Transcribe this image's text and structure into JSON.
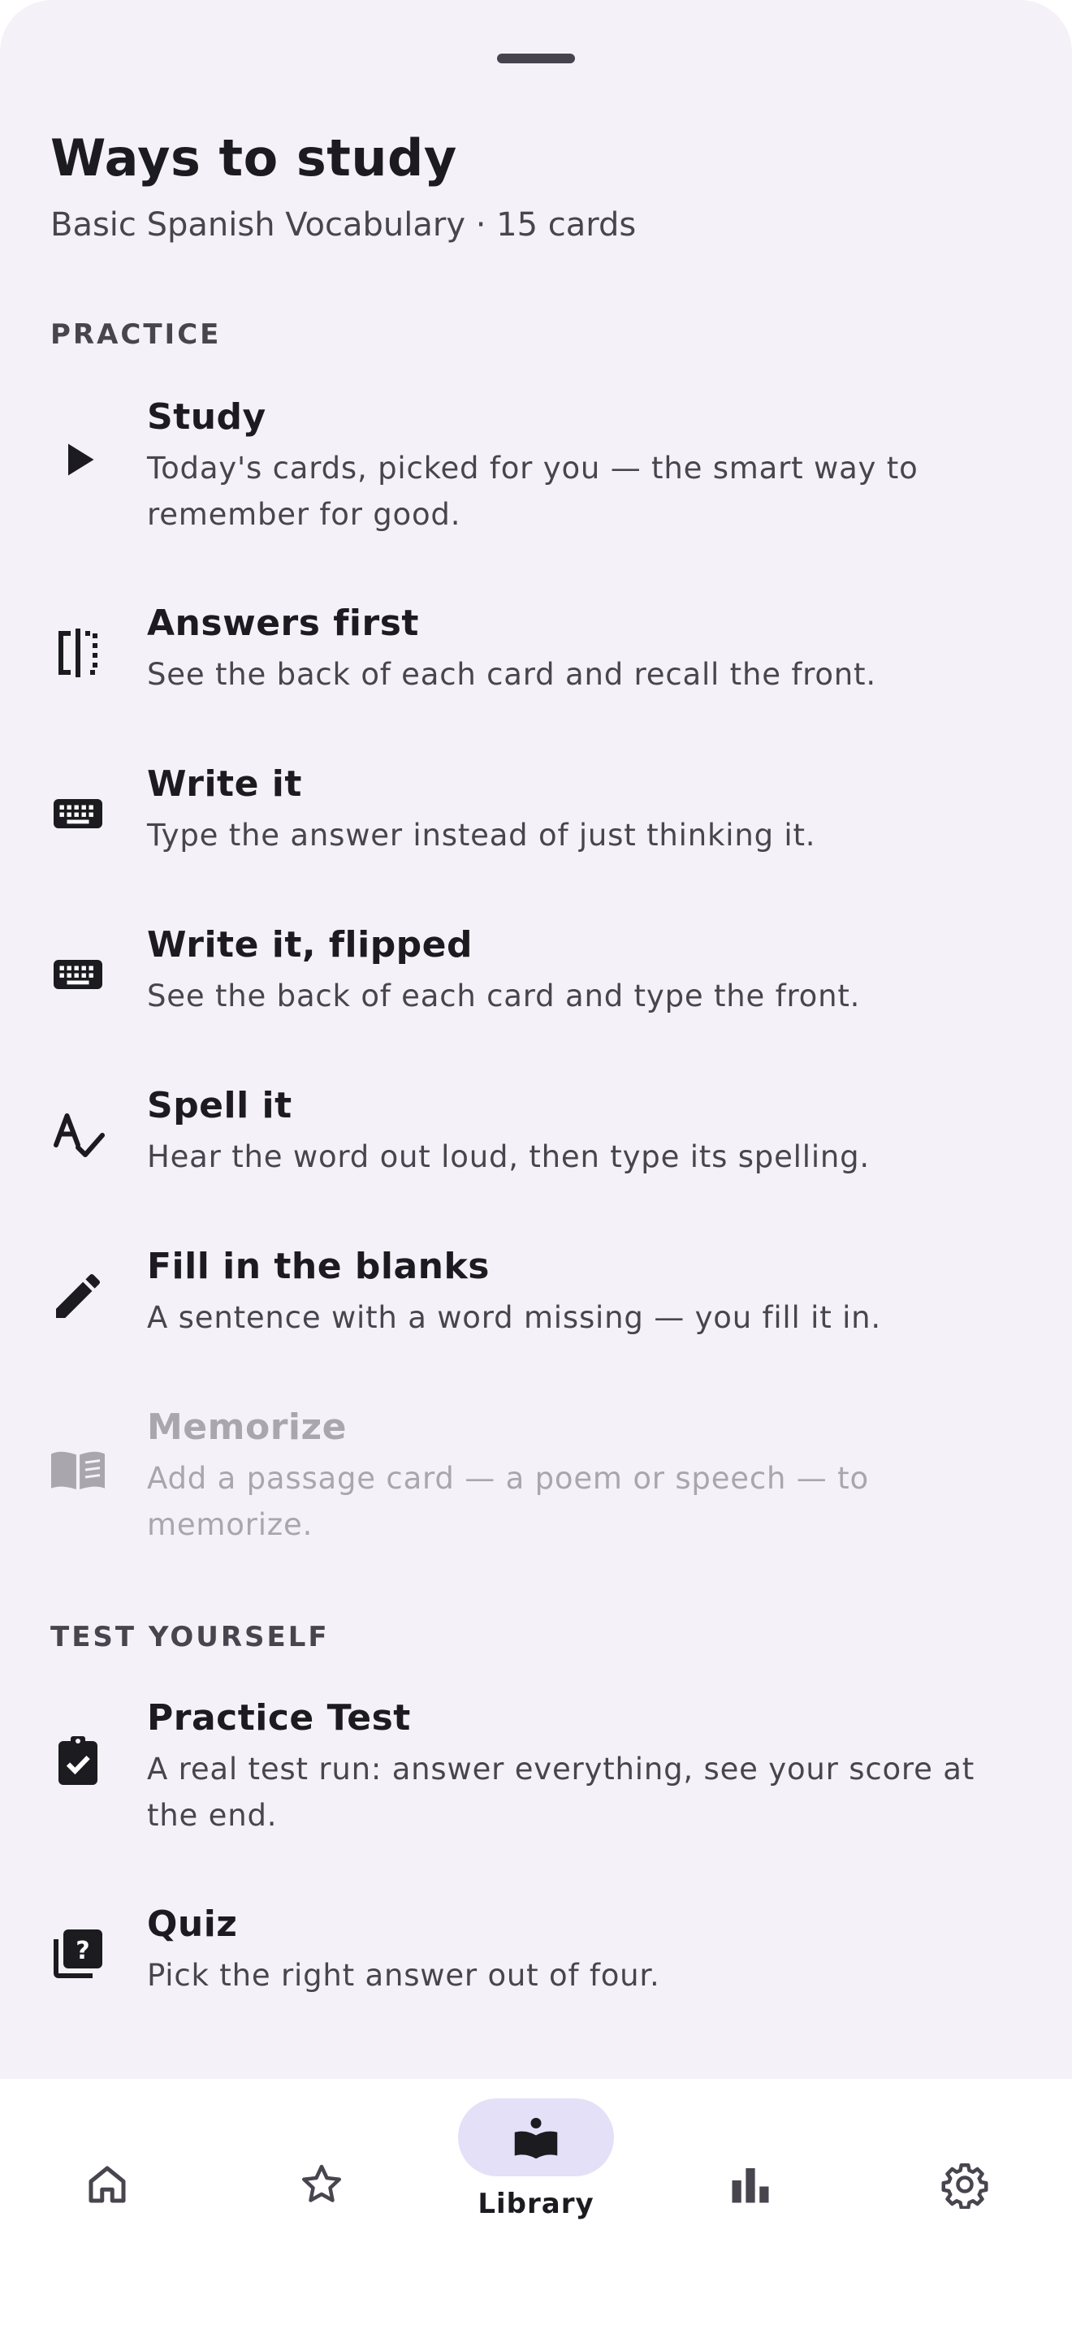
{
  "sheet": {
    "title": "Ways to study",
    "subtitle": "Basic Spanish Vocabulary · 15 cards"
  },
  "sections": {
    "practice": "PRACTICE",
    "test": "TEST YOURSELF"
  },
  "practice_items": [
    {
      "label": "Study",
      "desc": "Today's cards, picked for you — the smart way to remember for good.",
      "icon": "play-icon",
      "enabled": true
    },
    {
      "label": "Answers first",
      "desc": "See the back of each card and recall the front.",
      "icon": "flip-icon",
      "enabled": true
    },
    {
      "label": "Write it",
      "desc": "Type the answer instead of just thinking it.",
      "icon": "keyboard-icon",
      "enabled": true
    },
    {
      "label": "Write it, flipped",
      "desc": "See the back of each card and type the front.",
      "icon": "keyboard-icon",
      "enabled": true
    },
    {
      "label": "Spell it",
      "desc": "Hear the word out loud, then type its spelling.",
      "icon": "spellcheck-icon",
      "enabled": true
    },
    {
      "label": "Fill in the blanks",
      "desc": "A sentence with a word missing — you fill it in.",
      "icon": "pencil-icon",
      "enabled": true
    },
    {
      "label": "Memorize",
      "desc": "Add a passage card — a poem or speech — to memorize.",
      "icon": "book-open-icon",
      "enabled": false
    }
  ],
  "test_items": [
    {
      "label": "Practice Test",
      "desc": "A real test run: answer everything, see your score at the end.",
      "icon": "clipboard-check-icon",
      "enabled": true
    },
    {
      "label": "Quiz",
      "desc": "Pick the right answer out of four.",
      "icon": "quiz-icon",
      "enabled": true
    }
  ],
  "nav": {
    "active_label": "Library",
    "items": [
      {
        "icon": "home-icon"
      },
      {
        "icon": "star-icon"
      },
      {
        "icon": "library-icon",
        "label": "Library",
        "active": true
      },
      {
        "icon": "bar-chart-icon"
      },
      {
        "icon": "gear-icon"
      }
    ]
  },
  "colors": {
    "sheet_bg": "#f4f2f8",
    "text_primary": "#1c1b1f",
    "text_secondary": "#49454f",
    "text_disabled": "#a9a6ae",
    "nav_pill": "#e4e0f8"
  }
}
